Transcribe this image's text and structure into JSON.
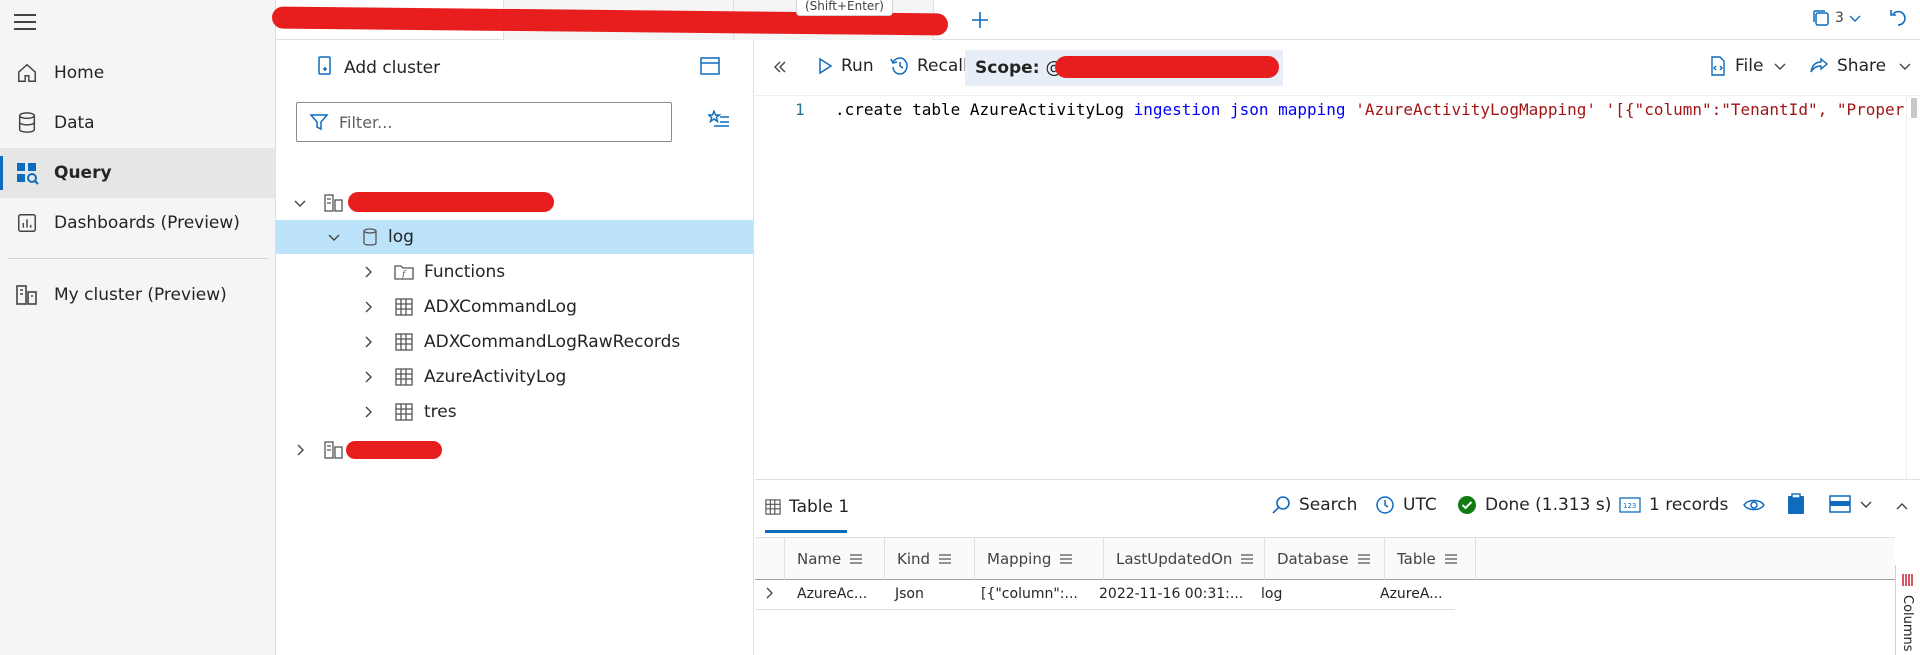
{
  "nav": {
    "items": [
      {
        "label": "Home",
        "icon": "home-icon"
      },
      {
        "label": "Data",
        "icon": "database-icon"
      },
      {
        "label": "Query",
        "icon": "query-icon",
        "active": true
      },
      {
        "label": "Dashboards (Preview)",
        "icon": "dashboard-icon"
      },
      {
        "label": "My cluster (Preview)",
        "icon": "cluster-icon"
      }
    ]
  },
  "tabs": {
    "tooltip": "(Shift+Enter)",
    "count": "3"
  },
  "explorer": {
    "add_cluster": "Add cluster",
    "filter_placeholder": "Filter...",
    "tree": {
      "database": "log",
      "children": [
        "Functions",
        "ADXCommandLog",
        "ADXCommandLogRawRecords",
        "AzureActivityLog",
        "tres"
      ]
    }
  },
  "toolbar": {
    "run": "Run",
    "recall": "Recall",
    "scope_label": "Scope:",
    "scope_value": "@s",
    "file": "File",
    "share": "Share"
  },
  "editor": {
    "line_number": "1",
    "tokens": [
      {
        "t": ".create table AzureActivityLog ",
        "c": "plain"
      },
      {
        "t": "ingestion json mapping ",
        "c": "kw"
      },
      {
        "t": "'AzureActivityLogMapping'",
        "c": "str"
      },
      {
        "t": " ",
        "c": "plain"
      },
      {
        "t": "'[{\"column\":\"TenantId\", \"Properti",
        "c": "str"
      }
    ]
  },
  "results": {
    "tab": "Table 1",
    "search": "Search",
    "utc": "UTC",
    "status": "Done (1.313 s)",
    "records": "1 records",
    "columns_label": "Columns",
    "headers": [
      "Name",
      "Kind",
      "Mapping",
      "LastUpdatedOn",
      "Database",
      "Table"
    ],
    "rows": [
      [
        "AzureAc...",
        "Json",
        "[{\"column\":...",
        "2022-11-16 00:31:...",
        "log",
        "AzureA..."
      ]
    ]
  },
  "colors": {
    "accent": "#0f6cbd",
    "selected_row": "#bde3fb",
    "success": "#107c10",
    "redaction": "#e81e1e"
  }
}
